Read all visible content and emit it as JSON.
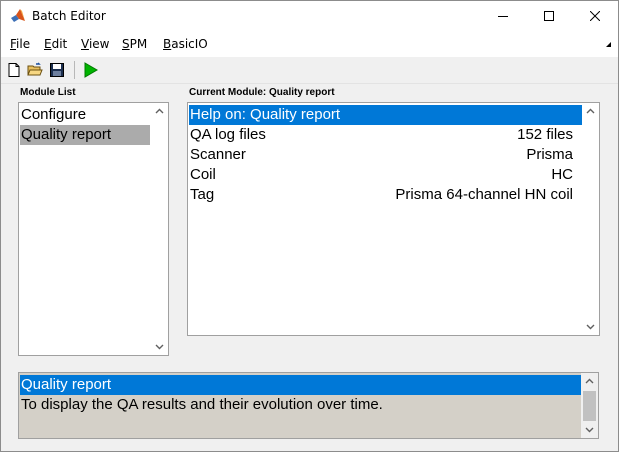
{
  "window": {
    "title": "Batch Editor",
    "icon": "matlab-icon"
  },
  "window_controls": {
    "minimize": "minimize-icon",
    "maximize": "maximize-icon",
    "close": "close-icon"
  },
  "menu": [
    {
      "underline": "F",
      "rest": "ile"
    },
    {
      "underline": "E",
      "rest": "dit"
    },
    {
      "underline": "V",
      "rest": "iew"
    },
    {
      "underline": "S",
      "rest": "PM"
    },
    {
      "underline": "B",
      "rest": "asicIO"
    }
  ],
  "toolbar": {
    "icons": [
      "new-file-icon",
      "open-folder-icon",
      "save-icon",
      "run-icon"
    ]
  },
  "module_list": {
    "label": "Module List",
    "items": [
      {
        "label": "Configure"
      },
      {
        "label": "Quality report"
      }
    ],
    "selected_index": 1
  },
  "current_module": {
    "label": "Current Module: Quality report",
    "rows": [
      {
        "name": "Help on: Quality report",
        "value": ""
      },
      {
        "name": "QA log files",
        "value": "152 files"
      },
      {
        "name": "Scanner",
        "value": "Prisma"
      },
      {
        "name": "Coil",
        "value": "HC"
      },
      {
        "name": "Tag",
        "value": "Prisma 64-channel HN coil"
      }
    ],
    "selected_index": 0
  },
  "help_text": {
    "title": "Quality report",
    "description": "To display the QA results and their evolution over time."
  },
  "colors": {
    "selection_blue": "#0078d7",
    "selection_gray": "#ababab",
    "run_green": "#00b400"
  }
}
